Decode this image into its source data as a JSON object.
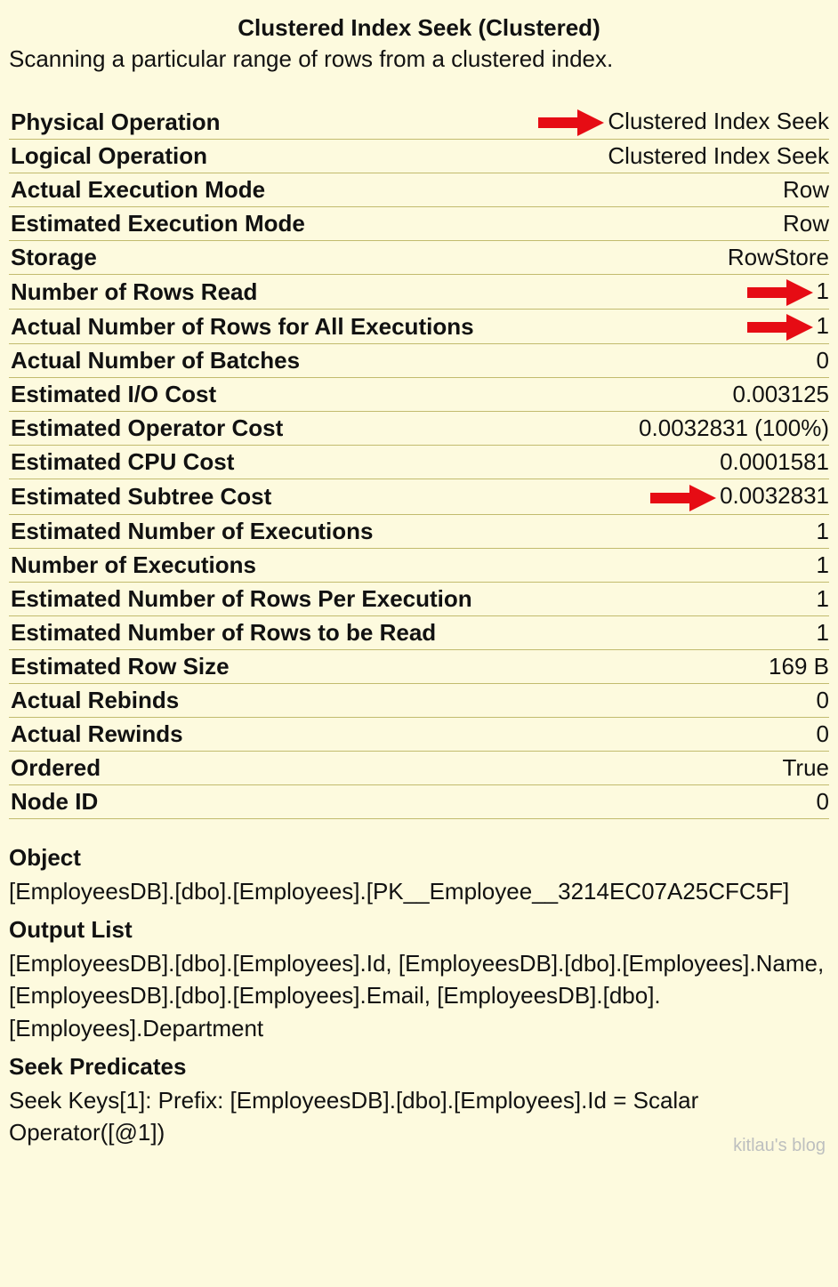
{
  "title": "Clustered Index Seek (Clustered)",
  "description": "Scanning a particular range of rows from a clustered index.",
  "rows": [
    {
      "label": "Physical Operation",
      "value": "Clustered Index Seek",
      "arrow": true
    },
    {
      "label": "Logical Operation",
      "value": "Clustered Index Seek"
    },
    {
      "label": "Actual Execution Mode",
      "value": "Row"
    },
    {
      "label": "Estimated Execution Mode",
      "value": "Row"
    },
    {
      "label": "Storage",
      "value": "RowStore"
    },
    {
      "label": "Number of Rows Read",
      "value": "1",
      "arrow": true
    },
    {
      "label": "Actual Number of Rows for All Executions",
      "value": "1",
      "arrow": true
    },
    {
      "label": "Actual Number of Batches",
      "value": "0"
    },
    {
      "label": "Estimated I/O Cost",
      "value": "0.003125"
    },
    {
      "label": "Estimated Operator Cost",
      "value": "0.0032831 (100%)"
    },
    {
      "label": "Estimated CPU Cost",
      "value": "0.0001581"
    },
    {
      "label": "Estimated Subtree Cost",
      "value": "0.0032831",
      "arrow": true
    },
    {
      "label": "Estimated Number of Executions",
      "value": "1"
    },
    {
      "label": "Number of Executions",
      "value": "1"
    },
    {
      "label": "Estimated Number of Rows Per Execution",
      "value": "1"
    },
    {
      "label": "Estimated Number of Rows to be Read",
      "value": "1"
    },
    {
      "label": "Estimated Row Size",
      "value": "169 B"
    },
    {
      "label": "Actual Rebinds",
      "value": "0"
    },
    {
      "label": "Actual Rewinds",
      "value": "0"
    },
    {
      "label": "Ordered",
      "value": "True"
    },
    {
      "label": "Node ID",
      "value": "0"
    }
  ],
  "object": {
    "heading": "Object",
    "body": "[EmployeesDB].[dbo].[Employees].[PK__Employee__3214EC07A25CFC5F]"
  },
  "output_list": {
    "heading": "Output List",
    "body": "[EmployeesDB].[dbo].[Employees].Id, [EmployeesDB].[dbo].[Employees].Name, [EmployeesDB].[dbo].[Employees].Email, [EmployeesDB].[dbo].[Employees].Department"
  },
  "seek_predicates": {
    "heading": "Seek Predicates",
    "body": "Seek Keys[1]: Prefix: [EmployeesDB].[dbo].[Employees].Id = Scalar Operator([@1])"
  },
  "watermark": "kitlau's blog",
  "annotation_color": "#e60c14"
}
